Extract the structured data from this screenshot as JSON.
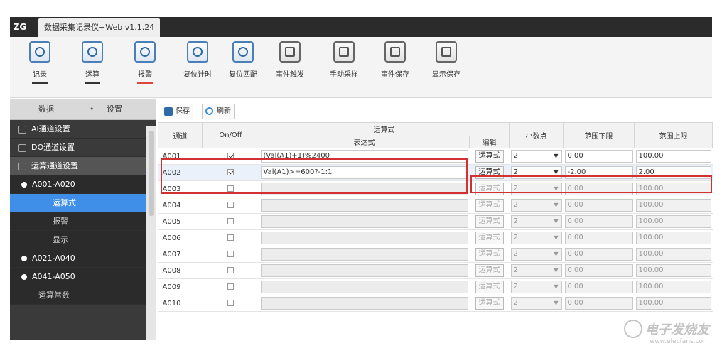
{
  "app": {
    "logo": "ZG",
    "title": "数据采集记录仪+Web v1.1.24"
  },
  "ribbon": [
    {
      "label": "记录",
      "icon": "record-icon"
    },
    {
      "label": "运算",
      "icon": "compute-icon"
    },
    {
      "label": "报警",
      "icon": "alarm-icon"
    },
    {
      "label": "复位计时",
      "icon": "reset-timer-icon"
    },
    {
      "label": "复位匹配",
      "icon": "reset-match-icon"
    },
    {
      "label": "事件触发",
      "icon": "event-trigger-icon"
    },
    {
      "label": "手动采样",
      "icon": "manual-sample-icon"
    },
    {
      "label": "事件保存",
      "icon": "event-save-icon"
    },
    {
      "label": "显示保存",
      "icon": "display-save-icon"
    }
  ],
  "sidebar": {
    "tabs": [
      "数据",
      "设置"
    ],
    "items": [
      {
        "label": "AI通道设置"
      },
      {
        "label": "DO通道设置"
      },
      {
        "label": "运算通道设置"
      },
      {
        "label": "A001-A020"
      },
      {
        "label": "运算式"
      },
      {
        "label": "报警"
      },
      {
        "label": "显示"
      },
      {
        "label": "A021-A040"
      },
      {
        "label": "A041-A050"
      },
      {
        "label": "运算常数"
      }
    ]
  },
  "toolbar": {
    "save": "保存",
    "refresh": "刷新"
  },
  "table": {
    "headers": {
      "channel": "通道",
      "onoff": "On/Off",
      "formula_group": "运算式",
      "expression": "表达式",
      "edit": "编辑",
      "decimal": "小数点",
      "lower": "范围下限",
      "upper": "范围上限"
    },
    "edit_label": "运算式",
    "rows": [
      {
        "ch": "A001",
        "on": true,
        "expr": "(Val(A1)+1)%2400",
        "dec": "2",
        "low": "0.00",
        "up": "100.00"
      },
      {
        "ch": "A002",
        "on": true,
        "expr": "Val(A1)>=600?-1:1",
        "dec": "2",
        "low": "-2.00",
        "up": "2.00"
      },
      {
        "ch": "A003",
        "on": false,
        "expr": "",
        "dec": "2",
        "low": "0.00",
        "up": "100.00"
      },
      {
        "ch": "A004",
        "on": false,
        "expr": "",
        "dec": "2",
        "low": "0.00",
        "up": "100.00"
      },
      {
        "ch": "A005",
        "on": false,
        "expr": "",
        "dec": "2",
        "low": "0.00",
        "up": "100.00"
      },
      {
        "ch": "A006",
        "on": false,
        "expr": "",
        "dec": "2",
        "low": "0.00",
        "up": "100.00"
      },
      {
        "ch": "A007",
        "on": false,
        "expr": "",
        "dec": "2",
        "low": "0.00",
        "up": "100.00"
      },
      {
        "ch": "A008",
        "on": false,
        "expr": "",
        "dec": "2",
        "low": "0.00",
        "up": "100.00"
      },
      {
        "ch": "A009",
        "on": false,
        "expr": "",
        "dec": "2",
        "low": "0.00",
        "up": "100.00"
      },
      {
        "ch": "A010",
        "on": false,
        "expr": "",
        "dec": "2",
        "low": "0.00",
        "up": "100.00"
      }
    ]
  },
  "watermark": {
    "main": "电子发烧友",
    "sub": "www.elecfans.com"
  },
  "colors": {
    "highlight": "#d3312f",
    "active_item": "#3f8ee8",
    "alarm_underline": "#e0453a"
  }
}
